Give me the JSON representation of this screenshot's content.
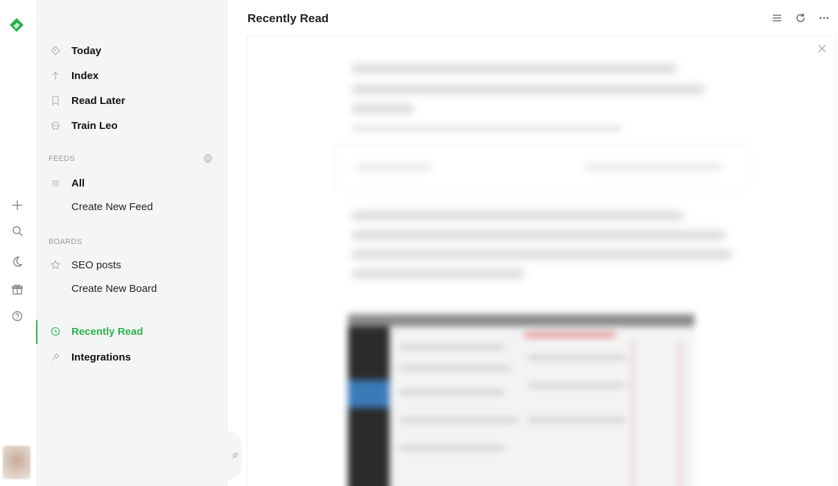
{
  "colors": {
    "accent": "#2bb24c",
    "sidebar_bg": "#f4f5f7",
    "muted": "#9a9a9a"
  },
  "rail": {
    "logo_icon": "feedly-logo-icon",
    "buttons": [
      {
        "icon": "plus-icon"
      },
      {
        "icon": "search-icon"
      },
      {
        "icon": "moon-icon"
      },
      {
        "icon": "gift-icon"
      },
      {
        "icon": "help-icon"
      }
    ]
  },
  "nav": {
    "primary": [
      {
        "label": "Today",
        "icon": "today-icon"
      },
      {
        "label": "Index",
        "icon": "arrow-up-icon"
      },
      {
        "label": "Read Later",
        "icon": "bookmark-icon"
      },
      {
        "label": "Train Leo",
        "icon": "leo-icon"
      }
    ],
    "feeds_label": "FEEDS",
    "feeds": [
      {
        "label": "All",
        "icon": "list-icon"
      },
      {
        "label": "Create New Feed"
      }
    ],
    "boards_label": "BOARDS",
    "boards": [
      {
        "label": "SEO posts",
        "icon": "star-icon"
      },
      {
        "label": "Create New Board"
      }
    ],
    "bottom": [
      {
        "label": "Recently Read",
        "icon": "clock-icon",
        "active": true
      },
      {
        "label": "Integrations",
        "icon": "plug-icon"
      }
    ]
  },
  "header": {
    "title": "Recently Read",
    "actions": [
      "list-view-icon",
      "refresh-icon",
      "more-icon"
    ]
  }
}
